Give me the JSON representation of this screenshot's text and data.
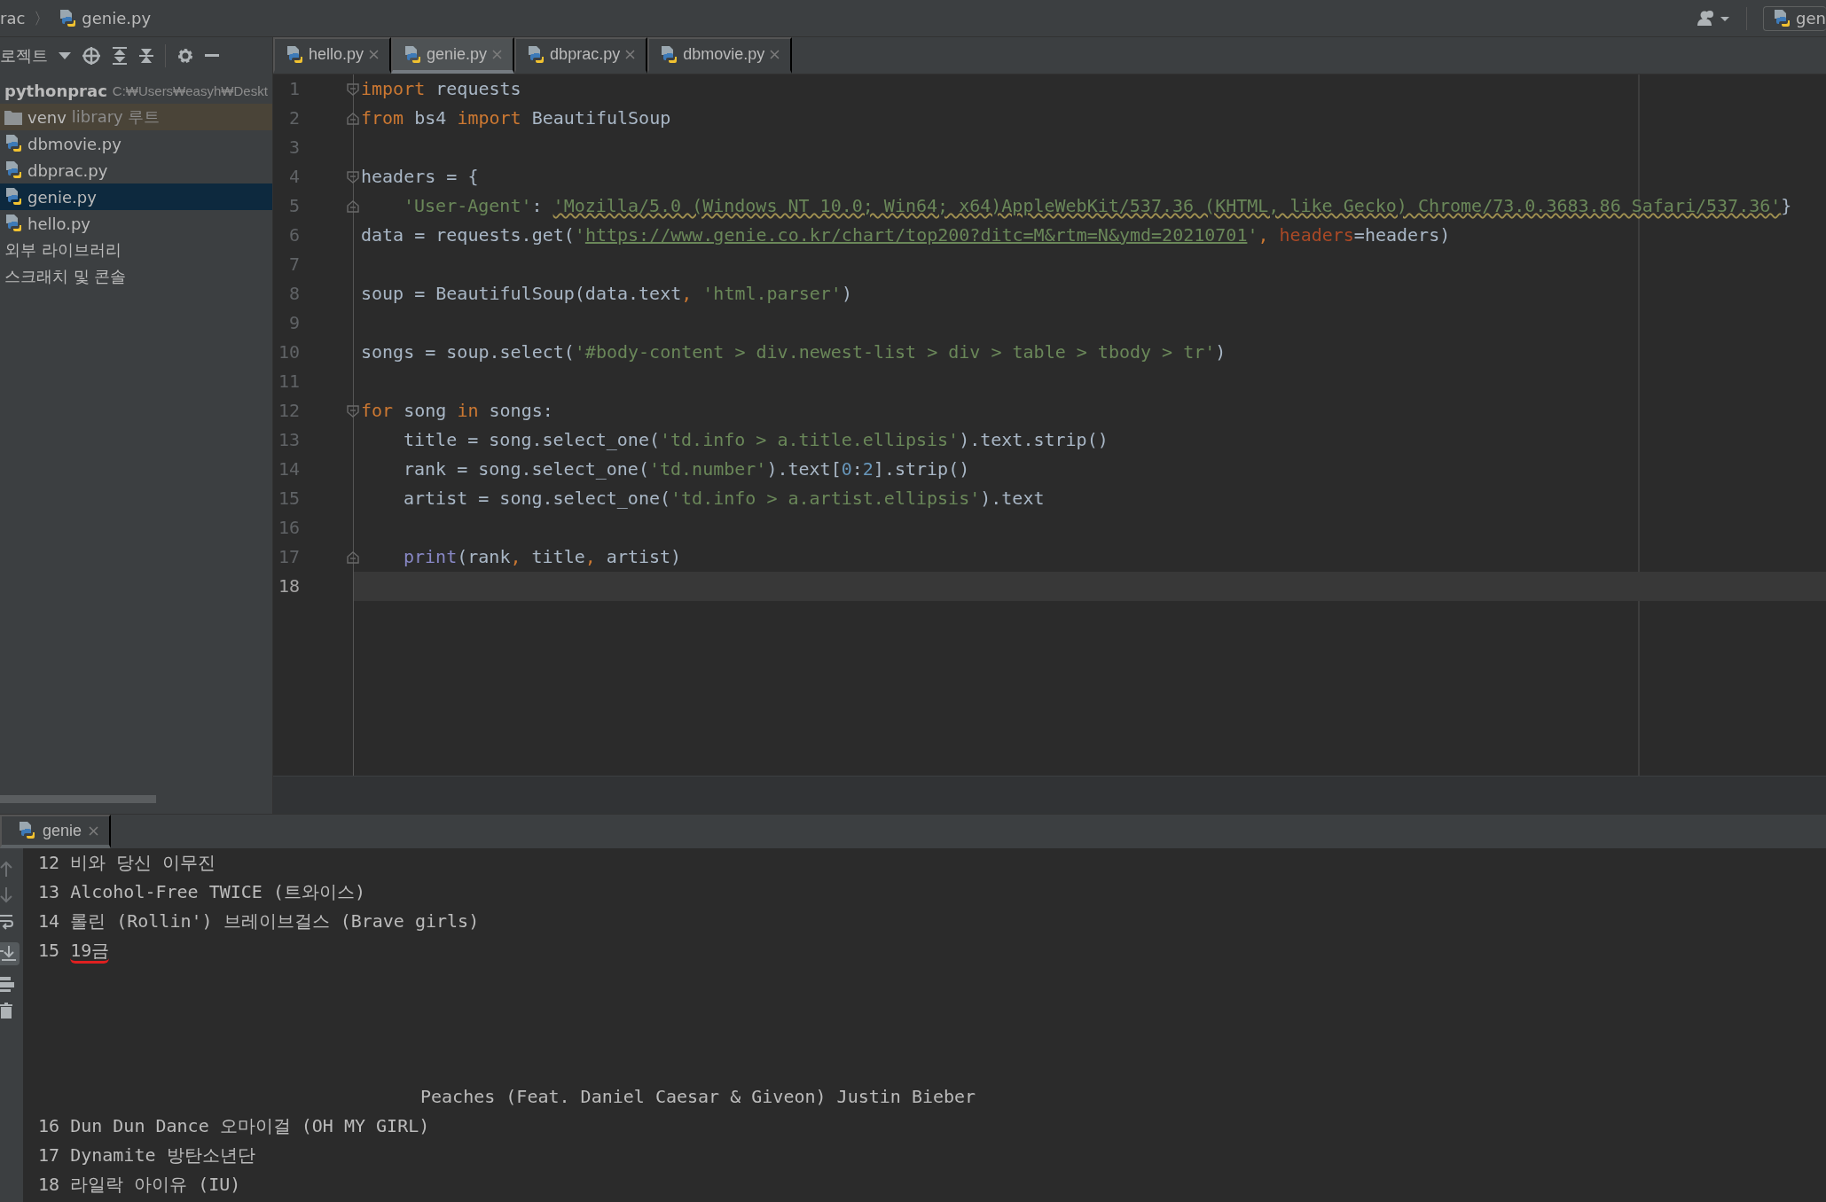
{
  "breadcrumb": {
    "project": "rac",
    "separator": "〉",
    "file": "genie.py"
  },
  "run_config": {
    "label": "gen"
  },
  "project_panel": {
    "title": "로젝트",
    "tree": [
      {
        "name": "pythonprac",
        "path": "C:₩Users₩easyh₩Deskt",
        "kind": "project",
        "selected": false,
        "children": [
          {
            "name": "venv",
            "note": "library 루트",
            "kind": "folder",
            "selected": false
          },
          {
            "name": "dbmovie.py",
            "kind": "python",
            "selected": false
          },
          {
            "name": "dbprac.py",
            "kind": "python",
            "selected": false
          },
          {
            "name": "genie.py",
            "kind": "python",
            "selected": true
          },
          {
            "name": "hello.py",
            "kind": "python",
            "selected": false
          }
        ]
      },
      {
        "name": "외부 라이브러리",
        "kind": "plain",
        "selected": false
      },
      {
        "name": "스크래치 및 콘솔",
        "kind": "plain",
        "selected": false
      }
    ]
  },
  "tabs": [
    {
      "label": "hello.py",
      "selected": false
    },
    {
      "label": "genie.py",
      "selected": true
    },
    {
      "label": "dbprac.py",
      "selected": false
    },
    {
      "label": "dbmovie.py",
      "selected": false
    }
  ],
  "code_lines": [
    {
      "number": "1",
      "fold_start": true,
      "fold_end": false,
      "indented": false,
      "current": false,
      "parts": [
        {
          "kind": "kw",
          "text": "import"
        },
        {
          "kind": "plain",
          "text": " requests"
        }
      ]
    },
    {
      "number": "2",
      "fold_start": false,
      "fold_end": true,
      "indented": false,
      "current": false,
      "parts": [
        {
          "kind": "kw",
          "text": "from"
        },
        {
          "kind": "plain",
          "text": " bs4 "
        },
        {
          "kind": "kw",
          "text": "import"
        },
        {
          "kind": "plain",
          "text": " BeautifulSoup"
        }
      ]
    },
    {
      "number": "3",
      "fold_start": false,
      "fold_end": false,
      "current": false
    },
    {
      "number": "4",
      "fold_start": true,
      "fold_end": false,
      "indented": false,
      "current": false,
      "parts": [
        {
          "kind": "plain",
          "text": "headers = {"
        }
      ]
    },
    {
      "number": "5",
      "fold_start": false,
      "fold_end": true,
      "indented": true,
      "current": false,
      "parts": [
        {
          "kind": "str",
          "text": "'User-Agent'"
        },
        {
          "kind": "plain",
          "text": ": "
        },
        {
          "kind": "typo",
          "text": "'Mozilla/5.0 (Windows NT 10.0; Win64; x64)AppleWebKit/537.36 (KHTML, like Gecko) Chrome/73.0.3683.86 Safari/537.36'"
        },
        {
          "kind": "plain",
          "text": "}"
        }
      ]
    },
    {
      "number": "6",
      "fold_start": false,
      "fold_end": false,
      "indented": false,
      "current": false,
      "parts": [
        {
          "kind": "plain",
          "text": "data = requests.get("
        },
        {
          "kind": "str",
          "text": "'"
        },
        {
          "kind": "url",
          "text": "https://www.genie.co.kr/chart/top200?ditc=M&rtm=N&ymd=20210701"
        },
        {
          "kind": "str",
          "text": "'"
        },
        {
          "kind": "kw",
          "text": ", "
        },
        {
          "kind": "param",
          "text": "headers"
        },
        {
          "kind": "plain",
          "text": "=headers)"
        }
      ]
    },
    {
      "number": "7",
      "fold_start": false,
      "fold_end": false,
      "current": false
    },
    {
      "number": "8",
      "fold_start": false,
      "fold_end": false,
      "indented": false,
      "current": false,
      "parts": [
        {
          "kind": "plain",
          "text": "soup = BeautifulSoup(data.text"
        },
        {
          "kind": "kw",
          "text": ", "
        },
        {
          "kind": "str",
          "text": "'html.parser'"
        },
        {
          "kind": "plain",
          "text": ")"
        }
      ]
    },
    {
      "number": "9",
      "fold_start": false,
      "fold_end": false,
      "current": false
    },
    {
      "number": "10",
      "fold_start": false,
      "fold_end": false,
      "indented": false,
      "current": false,
      "parts": [
        {
          "kind": "plain",
          "text": "songs = soup.select("
        },
        {
          "kind": "str",
          "text": "'#body-content > div.newest-list > div > table > tbody > tr'"
        },
        {
          "kind": "plain",
          "text": ")"
        }
      ]
    },
    {
      "number": "11",
      "fold_start": false,
      "fold_end": false,
      "current": false
    },
    {
      "number": "12",
      "fold_start": true,
      "fold_end": false,
      "indented": false,
      "current": false,
      "parts": [
        {
          "kind": "kw",
          "text": "for"
        },
        {
          "kind": "plain",
          "text": " song "
        },
        {
          "kind": "kw",
          "text": "in"
        },
        {
          "kind": "plain",
          "text": " songs:"
        }
      ]
    },
    {
      "number": "13",
      "fold_start": false,
      "fold_end": false,
      "indented": true,
      "current": false,
      "parts": [
        {
          "kind": "plain",
          "text": "title = song.select_one("
        },
        {
          "kind": "str",
          "text": "'td.info > a.title.ellipsis'"
        },
        {
          "kind": "plain",
          "text": ").text.strip()"
        }
      ]
    },
    {
      "number": "14",
      "fold_start": false,
      "fold_end": false,
      "indented": true,
      "current": false,
      "parts": [
        {
          "kind": "plain",
          "text": "rank = song.select_one("
        },
        {
          "kind": "str",
          "text": "'td.number'"
        },
        {
          "kind": "plain",
          "text": ").text["
        },
        {
          "kind": "num",
          "text": "0"
        },
        {
          "kind": "plain",
          "text": ":"
        },
        {
          "kind": "num",
          "text": "2"
        },
        {
          "kind": "plain",
          "text": "].strip()"
        }
      ]
    },
    {
      "number": "15",
      "fold_start": false,
      "fold_end": false,
      "indented": true,
      "current": false,
      "parts": [
        {
          "kind": "plain",
          "text": "artist = song.select_one("
        },
        {
          "kind": "str",
          "text": "'td.info > a.artist.ellipsis'"
        },
        {
          "kind": "plain",
          "text": ").text"
        }
      ]
    },
    {
      "number": "16",
      "fold_start": false,
      "fold_end": false,
      "current": false
    },
    {
      "number": "17",
      "fold_start": false,
      "fold_end": true,
      "indented": true,
      "current": false,
      "parts": [
        {
          "kind": "builtin",
          "text": "print"
        },
        {
          "kind": "plain",
          "text": "(rank"
        },
        {
          "kind": "kw",
          "text": ", "
        },
        {
          "kind": "plain",
          "text": "title"
        },
        {
          "kind": "kw",
          "text": ", "
        },
        {
          "kind": "plain",
          "text": "artist)"
        }
      ]
    },
    {
      "number": "18",
      "fold_start": false,
      "fold_end": false,
      "current": true
    }
  ],
  "run_tab": {
    "label": "genie"
  },
  "console_lines": [
    {
      "kind": "row",
      "rank": "12",
      "text": "비와 당신 이무진",
      "underlined": false
    },
    {
      "kind": "row",
      "rank": "13",
      "text": "Alcohol-Free TWICE (트와이스)",
      "underlined": false
    },
    {
      "kind": "row",
      "rank": "14",
      "text": "롤린 (Rollin') 브레이브걸스 (Brave girls)",
      "underlined": false
    },
    {
      "kind": "row",
      "rank": "15",
      "text": "19금",
      "underlined": true
    },
    {
      "kind": "continuation",
      "text": "Peaches (Feat. Daniel Caesar & Giveon) Justin Bieber"
    },
    {
      "kind": "row",
      "rank": "16",
      "text": "Dun Dun Dance 오마이걸 (OH MY GIRL)",
      "underlined": false
    },
    {
      "kind": "row",
      "rank": "17",
      "text": "Dynamite 방탄소년단",
      "underlined": false
    },
    {
      "kind": "row",
      "rank": "18",
      "text": "라일락 아이유 (IU)",
      "underlined": false
    }
  ]
}
